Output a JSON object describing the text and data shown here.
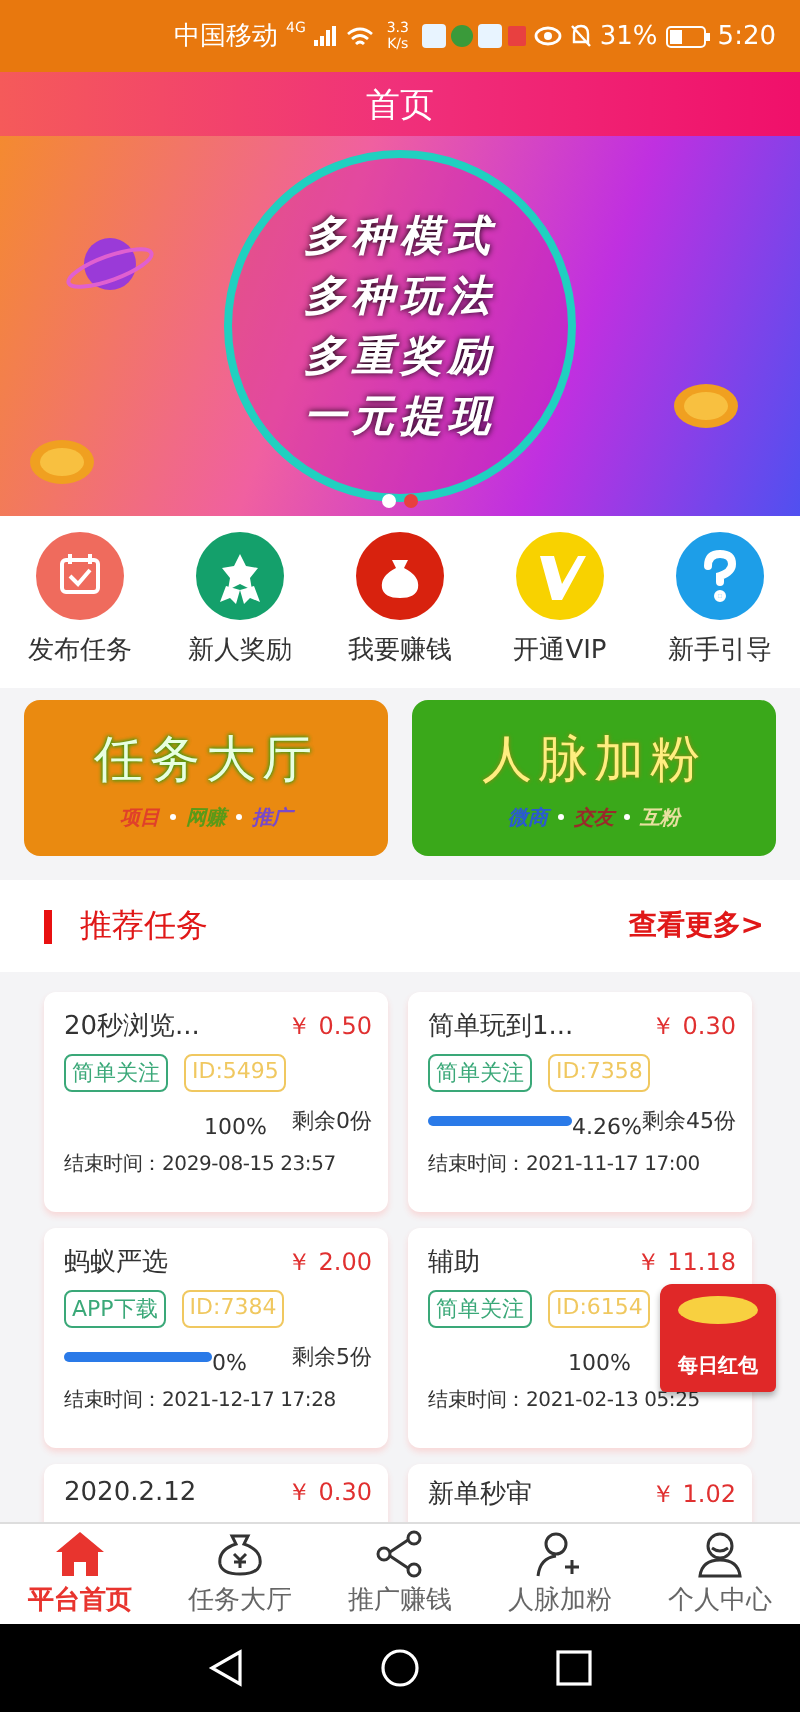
{
  "status_bar": {
    "carrier": "中国移动",
    "network": "4G",
    "speed": "3.3 K/s",
    "battery": "31%",
    "time": "5:20"
  },
  "header": {
    "title": "首页"
  },
  "banner": {
    "lines": [
      "多种模式",
      "多种玩法",
      "多重奖励",
      "一元提现"
    ],
    "dots": [
      {
        "selected": true
      },
      {
        "selected": false
      }
    ]
  },
  "quick_actions": [
    {
      "label": "发布任务",
      "kind": "calendar",
      "color": "#ef6b5d"
    },
    {
      "label": "新人奖励",
      "kind": "medal",
      "color": "#14a06b"
    },
    {
      "label": "我要赚钱",
      "kind": "moneybag",
      "color": "#d8220e"
    },
    {
      "label": "开通VIP",
      "kind": "vip",
      "color": "#f8d200"
    },
    {
      "label": "新手引导",
      "kind": "help",
      "color": "#1d9ee8"
    }
  ],
  "promo_cards": [
    {
      "title": "任务大厅",
      "kind": "orange",
      "tags": [
        {
          "text": "项目",
          "color": "#e0402a"
        },
        {
          "text": "网赚",
          "color": "#5a9a18"
        },
        {
          "text": "推广",
          "color": "#7a4ac8"
        }
      ]
    },
    {
      "title": "人脉加粉",
      "kind": "green",
      "tags": [
        {
          "text": "微商",
          "color": "#2a5ad0"
        },
        {
          "text": "交友",
          "color": "#9a2a2a"
        },
        {
          "text": "互粉",
          "color": "#e8e0a0"
        }
      ]
    }
  ],
  "section": {
    "title": "推荐任务",
    "more": "查看更多>"
  },
  "tasks": [
    {
      "title": "20秒浏览...",
      "price": "￥ 0.50",
      "type": "简单关注",
      "id": "ID:5495",
      "percent": "100%",
      "remaining": "剩余0份",
      "end_time": "结束时间：2029-08-15 23:57"
    },
    {
      "title": "简单玩到1...",
      "price": "￥ 0.30",
      "type": "简单关注",
      "id": "ID:7358",
      "level": 1,
      "percent": "4.26%",
      "remaining": "剩余45份",
      "end_time": "结束时间：2021-11-17 17:00"
    },
    {
      "title": "蚂蚁严选",
      "price": "￥ 2.00",
      "type": "APP下载",
      "id": "ID:7384",
      "level": 1,
      "percent": "0%",
      "remaining": "剩余5份",
      "end_time": "结束时间：2021-12-17 17:28"
    },
    {
      "title": "辅助",
      "price": "￥ 11.18",
      "type": "简单关注",
      "id": "ID:6154",
      "percent": "100%",
      "end_time": "结束时间：2021-02-13 05:25"
    },
    {
      "title": "2020.2.12",
      "price": "￥ 0.30"
    },
    {
      "title": "新单秒审",
      "price": "￥ 1.02"
    }
  ],
  "red_packet": {
    "label": "每日红包"
  },
  "tab_bar": [
    {
      "label": "平台首页",
      "kind": "home",
      "selected": true
    },
    {
      "label": "任务大厅",
      "kind": "bag",
      "selected": false
    },
    {
      "label": "推广赚钱",
      "kind": "share",
      "selected": false
    },
    {
      "label": "人脉加粉",
      "kind": "adduser",
      "selected": false
    },
    {
      "label": "个人中心",
      "kind": "user",
      "selected": false
    }
  ]
}
